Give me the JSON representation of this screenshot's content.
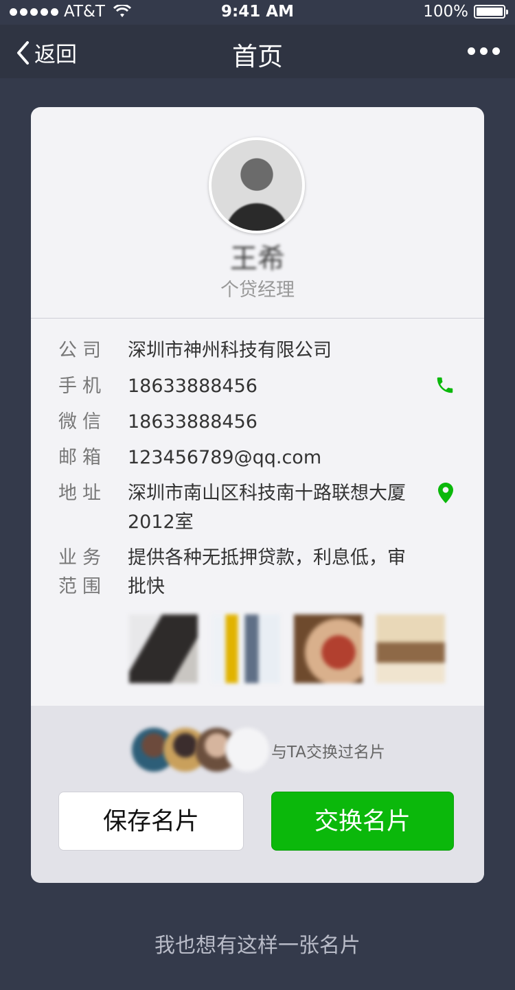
{
  "status_bar": {
    "carrier": "AT&T",
    "time": "9:41 AM",
    "battery": "100%"
  },
  "nav": {
    "back_label": "返回",
    "title": "首页"
  },
  "card": {
    "name": "王希",
    "job_title": "个贷经理",
    "fields": [
      {
        "label": "公司",
        "value": "深圳市神州科技有限公司"
      },
      {
        "label": "手机",
        "value": "18633888456"
      },
      {
        "label": "微信",
        "value": "18633888456"
      },
      {
        "label": "邮箱",
        "value": "123456789@qq.com"
      },
      {
        "label": "地址",
        "value": "深圳市南山区科技南十路联想大厦2012室"
      },
      {
        "label": "业务范围",
        "value": "提供各种无抵押贷款，利息低，审批快"
      }
    ],
    "icons": {
      "phone": "phone-icon",
      "location": "location-pin-icon",
      "accent_color": "#0bb80b"
    },
    "exchanged_text": "与TA交换过名片",
    "save_button": "保存名片",
    "exchange_button": "交换名片"
  },
  "footer": {
    "cta": "我也想有这样一张名片"
  }
}
